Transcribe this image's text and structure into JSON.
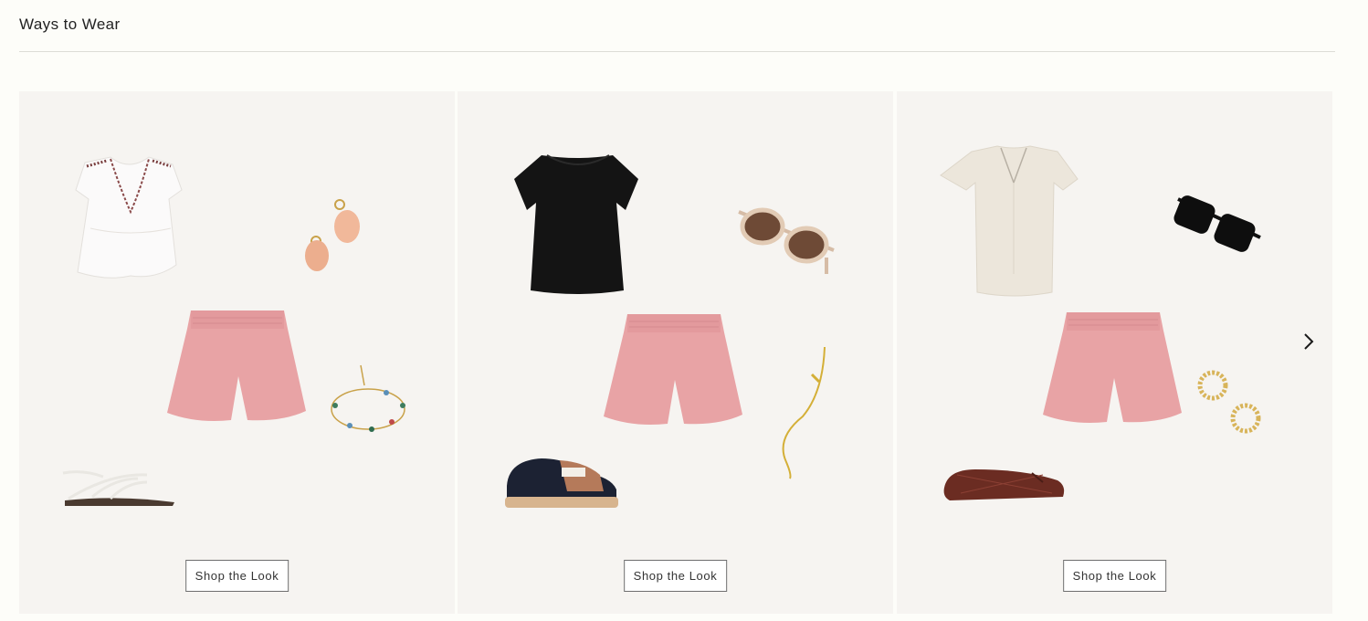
{
  "section": {
    "title": "Ways to Wear"
  },
  "looks": [
    {
      "button_label": "Shop the Look"
    },
    {
      "button_label": "Shop the Look"
    },
    {
      "button_label": "Shop the Look"
    }
  ],
  "icons": {
    "next": "chevron-right-icon"
  },
  "colors": {
    "background": "#fdfdf9",
    "card": "#f6f4f1",
    "shorts": "#e8a3a5"
  }
}
